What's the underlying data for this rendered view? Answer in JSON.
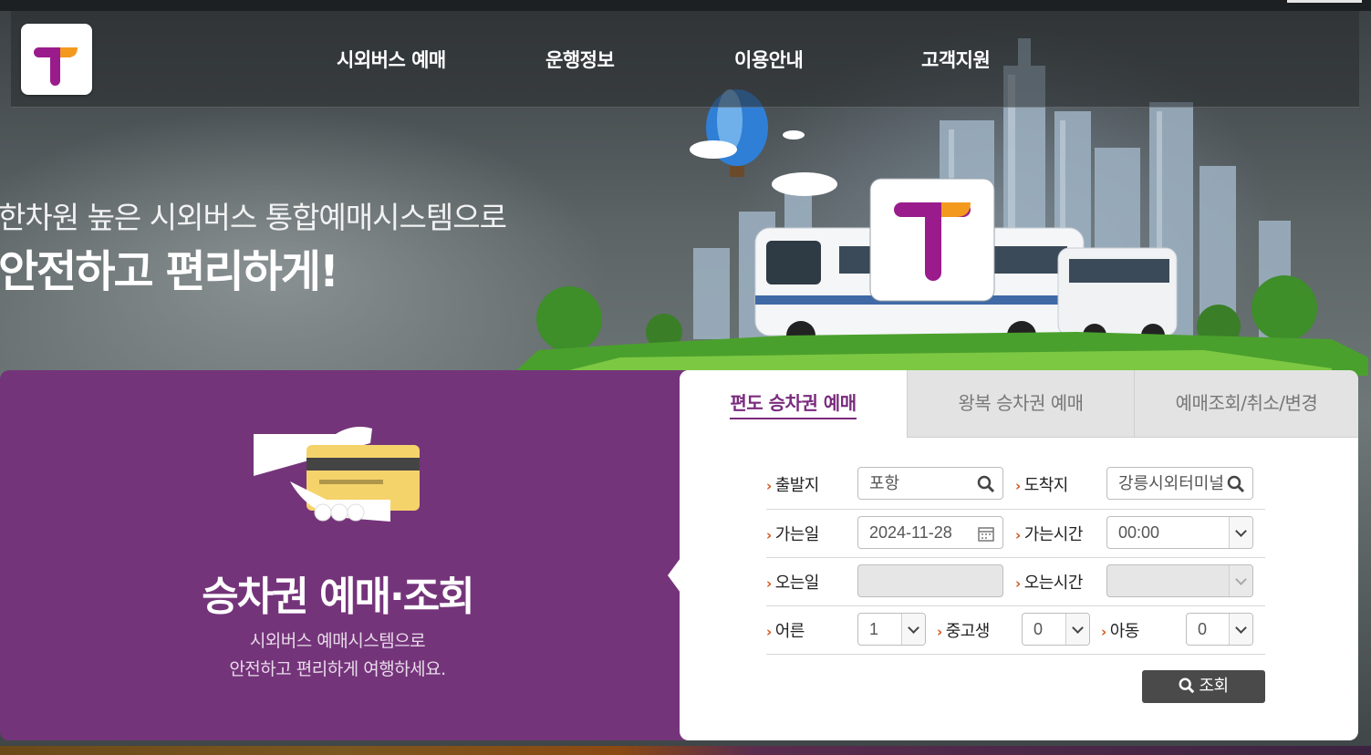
{
  "header": {
    "logo_icon": "t-logo-icon",
    "nav": [
      "시외버스 예매",
      "운행정보",
      "이용안내",
      "고객지원"
    ]
  },
  "hero": {
    "line1": "한차원 높은 시외버스 통합예매시스템으로",
    "line2": "안전하고 편리하게!"
  },
  "promo": {
    "icon": "ticket-card-hand-icon",
    "title": "승차권 예매·조회",
    "sub1": "시외버스 예매시스템으로",
    "sub2": "안전하고 편리하게 여행하세요."
  },
  "tabs": [
    "편도 승차권 예매",
    "왕복 승차권 예매",
    "예매조회/취소/변경"
  ],
  "form": {
    "depart_label": "출발지",
    "depart_value": "포항",
    "arrive_label": "도착지",
    "arrive_value": "강릉시외터미널",
    "go_date_label": "가는일",
    "go_date_value": "2024-11-28",
    "go_time_label": "가는시간",
    "go_time_value": "00:00",
    "return_date_label": "오는일",
    "return_time_label": "오는시간",
    "adult_label": "어른",
    "adult_value": "1",
    "student_label": "중고생",
    "student_value": "0",
    "child_label": "아동",
    "child_value": "0",
    "search_button": "조회"
  },
  "colors": {
    "brand_purple": "#74347a",
    "accent_orange": "#f39a1e",
    "arrow_orange": "#d3561a"
  }
}
